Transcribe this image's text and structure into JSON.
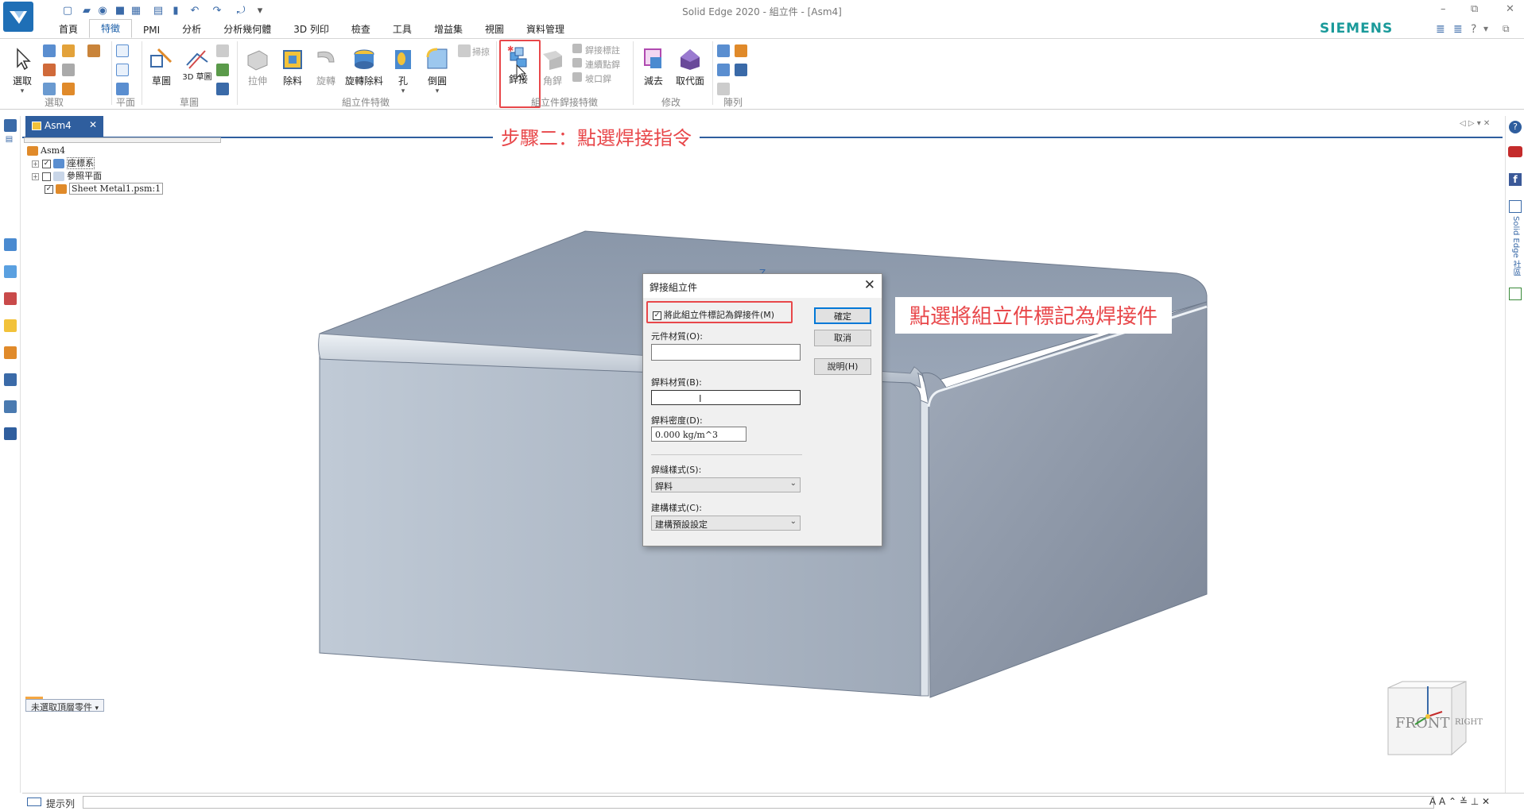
{
  "app": {
    "window_title": "Solid Edge 2020 - 組立件 - [Asm4]",
    "brand": "SIEMENS",
    "brand_color": "#1a9a9a",
    "accent_color": "#2f5e9e",
    "annotation_color": "#e8474a"
  },
  "quick_access": [
    "new-icon",
    "open-icon",
    "save-icon",
    "print-icon",
    "undo-icon",
    "redo-icon",
    "customize-icon"
  ],
  "tabs": [
    {
      "label": "首頁",
      "active": false
    },
    {
      "label": "特徵",
      "active": true
    },
    {
      "label": "PMI",
      "active": false
    },
    {
      "label": "分析",
      "active": false
    },
    {
      "label": "分析幾何體",
      "active": false
    },
    {
      "label": "3D 列印",
      "active": false
    },
    {
      "label": "檢查",
      "active": false
    },
    {
      "label": "工具",
      "active": false
    },
    {
      "label": "增益集",
      "active": false
    },
    {
      "label": "視圖",
      "active": false
    },
    {
      "label": "資料管理",
      "active": false
    }
  ],
  "ribbon": {
    "select": "選取",
    "sketch": "草圖",
    "sketch3d": "3D 草圖",
    "extrude": "拉伸",
    "cutout": "除料",
    "revolve": "旋轉",
    "revolve_cut": "旋轉除料",
    "hole": "孔",
    "round": "倒圓",
    "sweep": "掃掠",
    "weld": "銲接",
    "fillet_weld": "角銲",
    "weld_label": "銲接標註",
    "stitch_weld": "連續點銲",
    "groove_weld": "坡口銲",
    "subtract": "減去",
    "replace_face": "取代面",
    "groups": {
      "select": "選取",
      "plane": "平面",
      "sketch": "草圖",
      "assembly_features": "組立件特徵",
      "weld_features": "組立件銲接特徵",
      "modify": "修改",
      "pattern": "陣列"
    }
  },
  "document": {
    "tab": "Asm4"
  },
  "step_label": "步驟二：點選焊接指令",
  "tree": {
    "root": "Asm4",
    "items": [
      {
        "label": "座標系",
        "checked": true
      },
      {
        "label": "參照平面",
        "checked": false
      },
      {
        "label": "Sheet Metal1.psm:1",
        "checked": true
      }
    ]
  },
  "filter": {
    "label": "未選取頂層零件"
  },
  "axis_label": "Z",
  "viewcube": {
    "front": "FRONT",
    "right": "RIGHT"
  },
  "dialog": {
    "title": "銲接組立件",
    "mark_checkbox": {
      "label": "將此組立件標記為銲接件(M)",
      "checked": true
    },
    "component_material_label": "元件材質(O):",
    "component_material_value": "",
    "weld_material_label": "銲料材質(B):",
    "weld_material_value": "",
    "weld_density_label": "銲料密度(D):",
    "weld_density_value": "0.000 kg/m^3",
    "bead_style_label": "銲縫樣式(S):",
    "bead_style_value": "銲料",
    "build_style_label": "建構樣式(C):",
    "build_style_value": "建構預設設定",
    "ok": "確定",
    "cancel": "取消",
    "help": "說明(H)"
  },
  "annotation": "點選將組立件標記為焊接件",
  "status": {
    "prompt_label": "提示列"
  },
  "rightbar": {
    "label": "Solid Edge 社區"
  }
}
